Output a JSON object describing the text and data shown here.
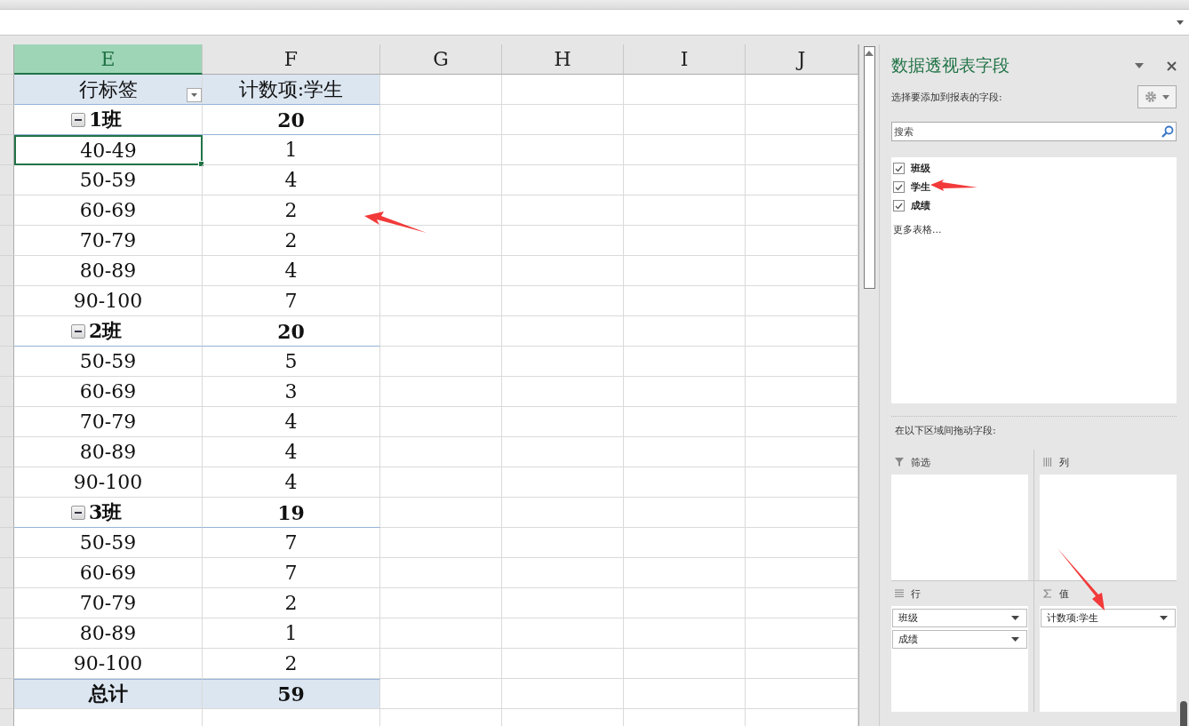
{
  "sheet": {
    "columns": [
      {
        "label": "E",
        "selected": true
      },
      {
        "label": "F",
        "selected": false
      },
      {
        "label": "G",
        "selected": false
      },
      {
        "label": "H",
        "selected": false
      },
      {
        "label": "I",
        "selected": false
      },
      {
        "label": "J",
        "selected": false
      }
    ],
    "rows": [
      {
        "kind": "header",
        "label": "行标签",
        "value": "计数项:学生",
        "selected": false
      },
      {
        "kind": "group",
        "label": "1班",
        "value": "20",
        "expanded": true,
        "selected": false
      },
      {
        "kind": "item",
        "label": "40-49",
        "value": "1",
        "selected": true
      },
      {
        "kind": "item",
        "label": "50-59",
        "value": "4",
        "selected": false
      },
      {
        "kind": "item",
        "label": "60-69",
        "value": "2",
        "selected": false
      },
      {
        "kind": "item",
        "label": "70-79",
        "value": "2",
        "selected": false
      },
      {
        "kind": "item",
        "label": "80-89",
        "value": "4",
        "selected": false
      },
      {
        "kind": "item",
        "label": "90-100",
        "value": "7",
        "selected": false
      },
      {
        "kind": "group",
        "label": "2班",
        "value": "20",
        "expanded": true,
        "selected": false
      },
      {
        "kind": "item",
        "label": "50-59",
        "value": "5",
        "selected": false
      },
      {
        "kind": "item",
        "label": "60-69",
        "value": "3",
        "selected": false
      },
      {
        "kind": "item",
        "label": "70-79",
        "value": "4",
        "selected": false
      },
      {
        "kind": "item",
        "label": "80-89",
        "value": "4",
        "selected": false
      },
      {
        "kind": "item",
        "label": "90-100",
        "value": "4",
        "selected": false
      },
      {
        "kind": "group",
        "label": "3班",
        "value": "19",
        "expanded": true,
        "selected": false
      },
      {
        "kind": "item",
        "label": "50-59",
        "value": "7",
        "selected": false
      },
      {
        "kind": "item",
        "label": "60-69",
        "value": "7",
        "selected": false
      },
      {
        "kind": "item",
        "label": "70-79",
        "value": "2",
        "selected": false
      },
      {
        "kind": "item",
        "label": "80-89",
        "value": "1",
        "selected": false
      },
      {
        "kind": "item",
        "label": "90-100",
        "value": "2",
        "selected": false
      },
      {
        "kind": "total",
        "label": "总计",
        "value": "59",
        "selected": false
      }
    ]
  },
  "panel": {
    "title": "数据透视表字段",
    "subtitle": "选择要添加到报表的字段:",
    "search": {
      "placeholder": "搜索"
    },
    "fields": [
      {
        "label": "班级",
        "checked": true
      },
      {
        "label": "学生",
        "checked": true
      },
      {
        "label": "成绩",
        "checked": true
      }
    ],
    "more": "更多表格...",
    "drag_hint": "在以下区域间拖动字段:",
    "areas": [
      {
        "kind": "filter",
        "title": "筛选"
      },
      {
        "kind": "columns",
        "title": "列"
      },
      {
        "kind": "rows",
        "title": "行",
        "items": [
          "班级",
          "成绩"
        ]
      },
      {
        "kind": "values",
        "title": "值",
        "items": [
          "计数项:学生"
        ]
      }
    ]
  }
}
